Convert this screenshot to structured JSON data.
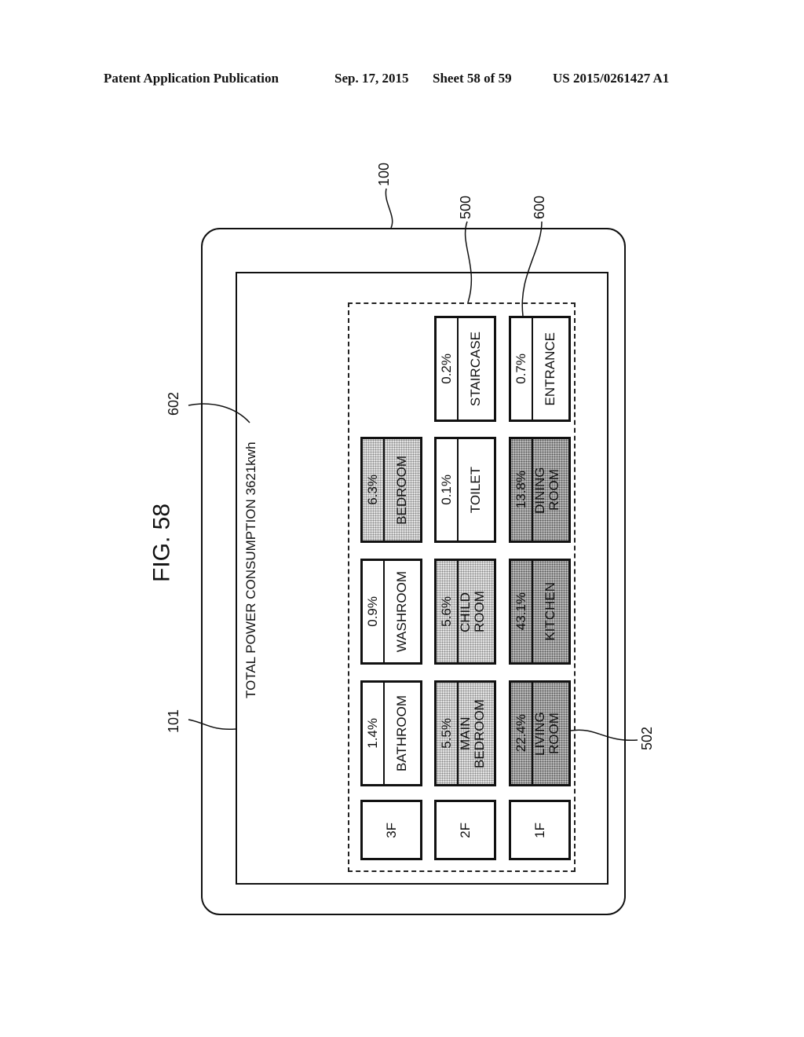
{
  "header": {
    "left": "Patent Application Publication",
    "date": "Sep. 17, 2015",
    "sheet": "Sheet 58 of 59",
    "number": "US 2015/0261427 A1"
  },
  "figure": {
    "title": "FIG. 58",
    "total_label": "TOTAL POWER CONSUMPTION 3621kwh",
    "refs": {
      "device": "100",
      "screen": "101",
      "area": "500",
      "cell": "502",
      "room_area": "600",
      "total": "602"
    }
  },
  "floors": [
    {
      "label": "3F",
      "rooms": [
        {
          "name": "BATHROOM",
          "percent": "1.4%",
          "shade": "none"
        },
        {
          "name": "WASHROOM",
          "percent": "0.9%",
          "shade": "none"
        },
        {
          "name": "BEDROOM",
          "percent": "6.3%",
          "shade": "light"
        }
      ]
    },
    {
      "label": "2F",
      "rooms": [
        {
          "name": "MAIN BEDROOM",
          "percent": "5.5%",
          "shade": "light"
        },
        {
          "name": "CHILD ROOM",
          "percent": "5.6%",
          "shade": "light"
        },
        {
          "name": "TOILET",
          "percent": "0.1%",
          "shade": "none"
        },
        {
          "name": "STAIRCASE",
          "percent": "0.2%",
          "shade": "none"
        }
      ]
    },
    {
      "label": "1F",
      "rooms": [
        {
          "name": "LIVING ROOM",
          "percent": "22.4%",
          "shade": "dark"
        },
        {
          "name": "KITCHEN",
          "percent": "43.1%",
          "shade": "dark"
        },
        {
          "name": "DINING ROOM",
          "percent": "13.8%",
          "shade": "dark"
        },
        {
          "name": "ENTRANCE",
          "percent": "0.7%",
          "shade": "none"
        }
      ]
    }
  ]
}
